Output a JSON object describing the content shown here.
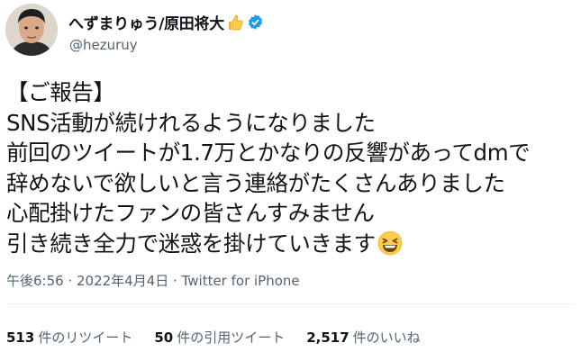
{
  "author": {
    "display_name": "へずまりゅう/原田将大",
    "handle": "@hezuruy",
    "name_emoji": "thumbs-up-icon",
    "verified": true,
    "verified_color": "#1d9bf0"
  },
  "tweet": {
    "lines": [
      "【ご報告】",
      "SNS活動が続けれるようになりました",
      "前回のツイートが1.7万とかなりの反響があってdmで",
      "辞めないで欲しいと言う連絡がたくさんありました",
      "心配掛けたファンの皆さんすみません",
      "引き続き全力で迷惑を掛けていきます"
    ],
    "trailing_emoji": "grinning-squinting-face-icon"
  },
  "meta": {
    "time": "午後6:56",
    "separator": " · ",
    "date": "2022年4月4日",
    "source": "Twitter for iPhone"
  },
  "stats": {
    "retweets": {
      "count": "513",
      "label": "件のリツイート"
    },
    "quotes": {
      "count": "50",
      "label": "件の引用ツイート"
    },
    "likes": {
      "count": "2,517",
      "label": "件のいいね"
    }
  },
  "colors": {
    "text": "#0f1419",
    "secondary": "#536471",
    "divider": "#eff3f4"
  }
}
